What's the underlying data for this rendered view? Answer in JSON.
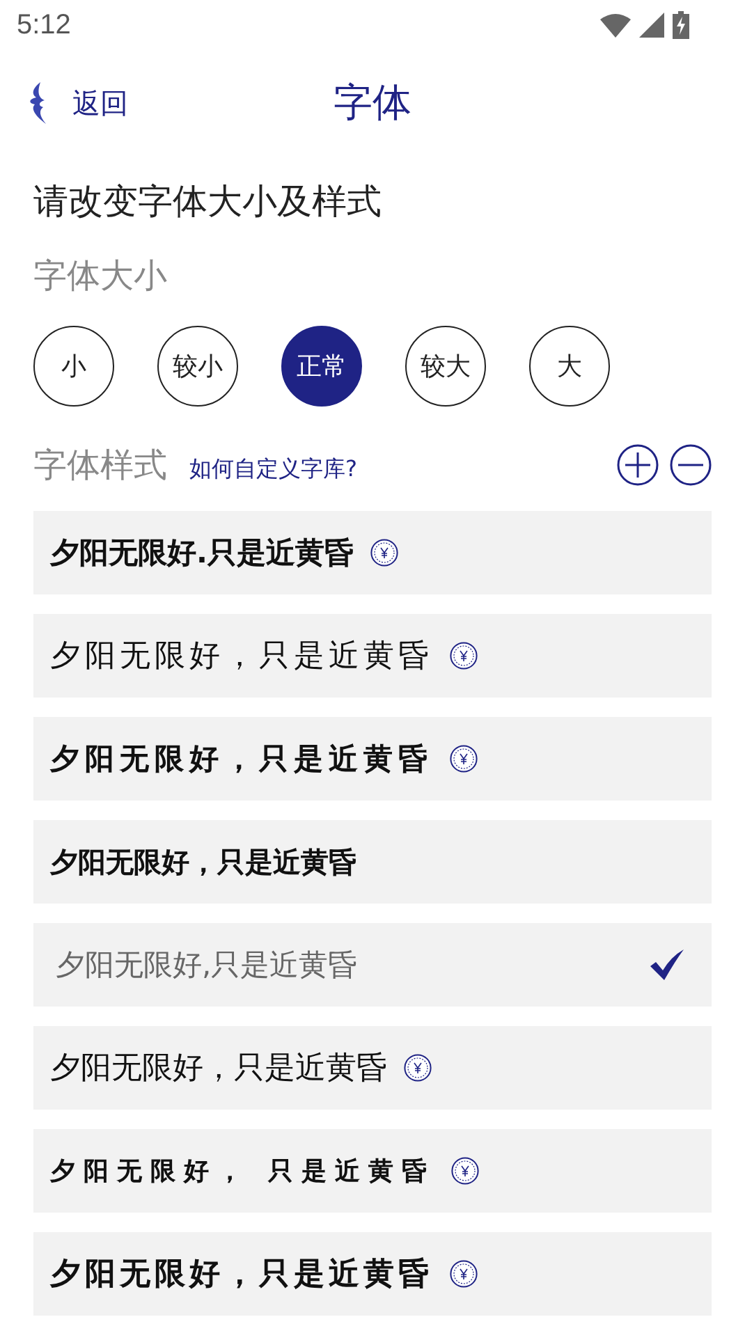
{
  "status_bar": {
    "time": "5:12"
  },
  "header": {
    "back": "返回",
    "title": "字体"
  },
  "intro": "请改变字体大小及样式",
  "size_section": {
    "label": "字体大小",
    "options": [
      {
        "label": "小",
        "selected": false
      },
      {
        "label": "较小",
        "selected": false
      },
      {
        "label": "正常",
        "selected": true
      },
      {
        "label": "较大",
        "selected": false
      },
      {
        "label": "大",
        "selected": false
      }
    ]
  },
  "style_section": {
    "label": "字体样式",
    "help_link": "如何自定义字库?",
    "fonts": [
      {
        "kind": "heavy",
        "text": "夕阳无限好.只是近黄昏",
        "paid": true,
        "selected": false
      },
      {
        "kind": "brush",
        "text": "夕阳无限好，只是近黄昏",
        "paid": true,
        "selected": false
      },
      {
        "kind": "brushbold",
        "text": "夕阳无限好，只是近黄昏",
        "paid": true,
        "selected": false
      },
      {
        "kind": "bold",
        "text": "夕阳无限好，只是近黄昏",
        "paid": false,
        "selected": false
      },
      {
        "kind": "light",
        "text": "夕阳无限好,只是近黄昏",
        "paid": false,
        "selected": true
      },
      {
        "kind": "song",
        "text": "夕阳无限好，只是近黄昏",
        "paid": true,
        "selected": false
      },
      {
        "kind": "wide",
        "text": "夕阳无限好， 只是近黄昏",
        "paid": true,
        "selected": false
      },
      {
        "kind": "widebold",
        "text": "夕阳无限好，只是近黄昏",
        "paid": true,
        "selected": false
      }
    ]
  }
}
